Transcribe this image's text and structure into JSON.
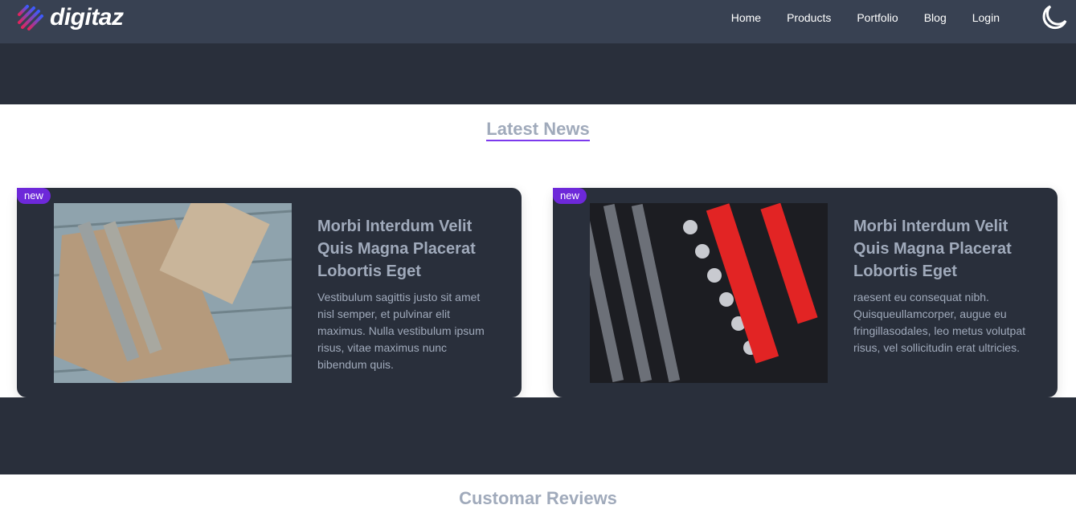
{
  "nav": {
    "logo": "digitaz",
    "links": [
      "Home",
      "Products",
      "Portfolio",
      "Blog",
      "Login"
    ]
  },
  "news": {
    "title": "Latest News",
    "cards": [
      {
        "badge": "new",
        "title": "Morbi Interdum Velit Quis Magna Placerat Lobortis Eget",
        "text": "Vestibulum sagittis justo sit amet nisl semper, et pulvinar elit maximus. Nulla vestibulum ipsum risus, vitae maximus nunc bibendum quis."
      },
      {
        "badge": "new",
        "title": "Morbi Interdum Velit Quis Magna Placerat Lobortis Eget",
        "text": "raesent eu consequat nibh. Quisqueullamcorper, augue eu fringillasodales, leo metus volutpat risus, vel sollicitudin erat ultricies."
      }
    ]
  },
  "reviews": {
    "title": "Customar Reviews"
  }
}
